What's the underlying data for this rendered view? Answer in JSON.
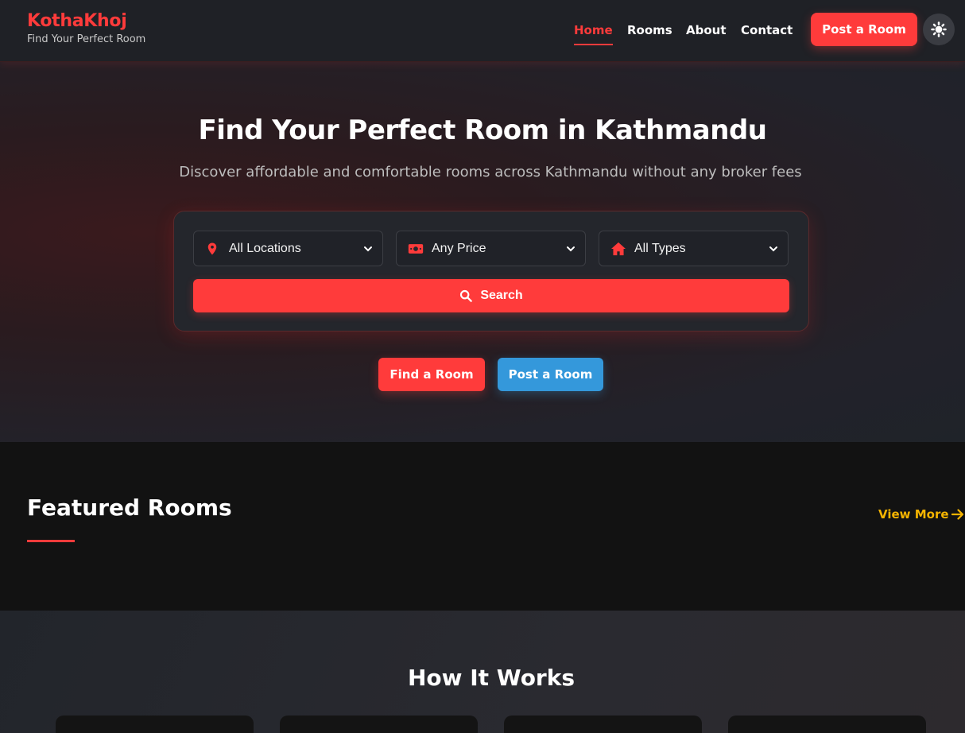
{
  "header": {
    "brand": "KothaKhoj",
    "tagline": "Find Your Perfect Room",
    "nav": [
      "Home",
      "Rooms",
      "About",
      "Contact"
    ],
    "active_nav": "Home",
    "post_button": "Post a Room",
    "theme_icon": "sun-icon"
  },
  "hero": {
    "title": "Find Your Perfect Room in Kathmandu",
    "subtitle": "Discover affordable and comfortable rooms across Kathmandu without any broker fees",
    "filters": {
      "location": "All Locations",
      "price": "Any Price",
      "type": "All Types"
    },
    "search_label": "Search",
    "cta_find": "Find a Room",
    "cta_post": "Post a Room"
  },
  "featured": {
    "title": "Featured Rooms",
    "view_more": "View More"
  },
  "how": {
    "title": "How It Works"
  },
  "colors": {
    "accent": "#ff3b3b",
    "secondary": "#3498db",
    "link": "#f5b400",
    "background": "#121212"
  }
}
